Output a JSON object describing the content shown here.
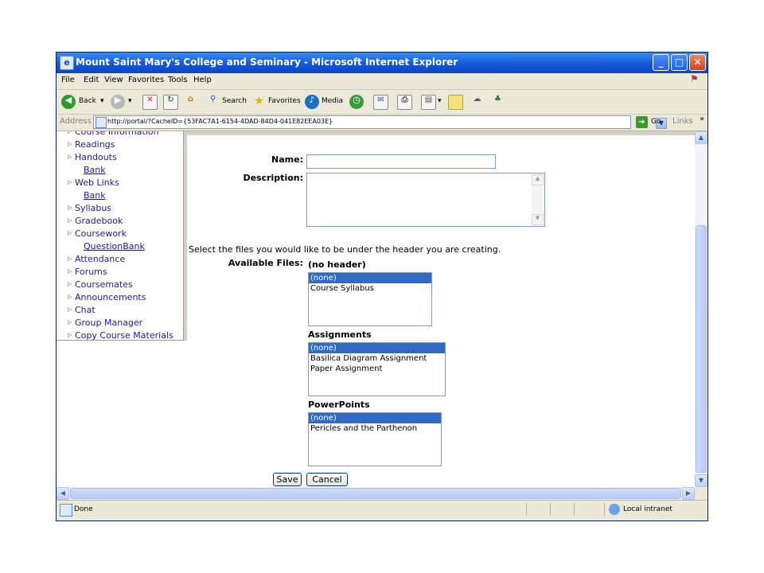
{
  "window": {
    "title": "Mount Saint Mary's College and Seminary - Microsoft Internet Explorer",
    "icon_name": "ie-page-icon"
  },
  "menubar": [
    "File",
    "Edit",
    "View",
    "Favorites",
    "Tools",
    "Help"
  ],
  "toolbar": {
    "back_label": "Back",
    "search_label": "Search",
    "favorites_label": "Favorites",
    "media_label": "Media"
  },
  "address": {
    "label": "Address",
    "url": "http://portal/?CacheID={53FAC7A1-6154-4DAD-84D4-041E82EEA03E}",
    "go_label": "Go",
    "links_label": "Links"
  },
  "sidebar": {
    "items": [
      {
        "label": "Course Information",
        "indent": false
      },
      {
        "label": "Readings",
        "indent": false
      },
      {
        "label": "Handouts",
        "indent": false
      },
      {
        "label": "Bank",
        "indent": true
      },
      {
        "label": "Web Links",
        "indent": false
      },
      {
        "label": "Bank",
        "indent": true
      },
      {
        "label": "Syllabus",
        "indent": false
      },
      {
        "label": "Gradebook",
        "indent": false
      },
      {
        "label": "Coursework",
        "indent": false
      },
      {
        "label": "QuestionBank",
        "indent": true
      },
      {
        "label": "Attendance",
        "indent": false
      },
      {
        "label": "Forums",
        "indent": false
      },
      {
        "label": "Coursemates",
        "indent": false
      },
      {
        "label": "Announcements",
        "indent": false
      },
      {
        "label": "Chat",
        "indent": false
      },
      {
        "label": "Group Manager",
        "indent": false
      },
      {
        "label": "Copy Course Materials",
        "indent": false
      }
    ]
  },
  "form": {
    "name_label": "Name:",
    "name_value": "",
    "description_label": "Description:",
    "description_value": "",
    "instructions": "Select the files you would like to be under the header you are creating.",
    "available_files_label": "Available Files:",
    "groups": [
      {
        "title": "(no header)",
        "options": [
          "(none)",
          "Course Syllabus"
        ],
        "selected": 0
      },
      {
        "title": "Assignments",
        "options": [
          "(none)",
          "Basilica Diagram Assignment",
          "Paper Assignment"
        ],
        "selected": 0
      },
      {
        "title": "PowerPoints",
        "options": [
          "(none)",
          "Pericles and the Parthenon"
        ],
        "selected": 0
      }
    ],
    "save_label": "Save",
    "cancel_label": "Cancel"
  },
  "statusbar": {
    "status": "Done",
    "zone": "Local intranet"
  },
  "colors": {
    "titlebar": "#1458d8",
    "link": "#1a1aa6",
    "selection": "#316ac5"
  }
}
